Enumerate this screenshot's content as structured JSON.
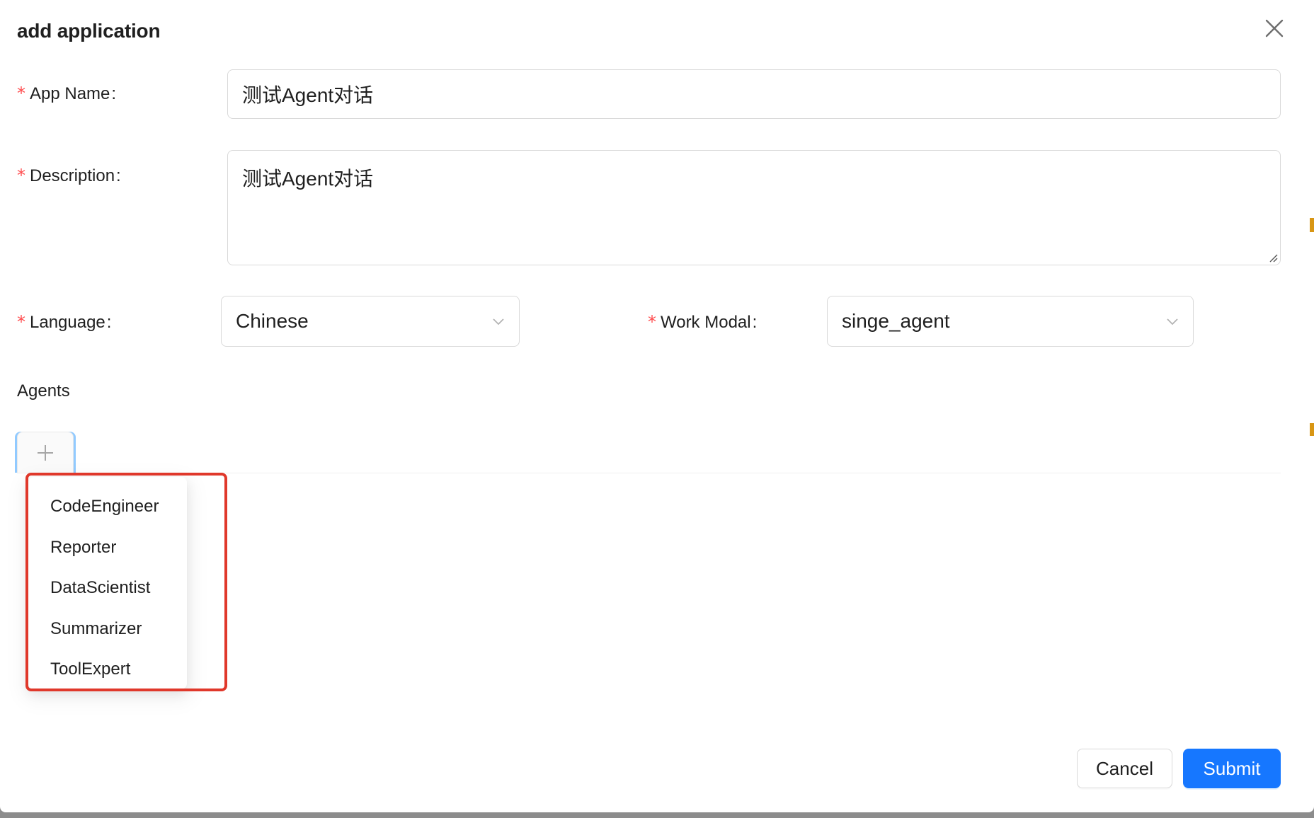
{
  "modal": {
    "title": "add application",
    "close_icon": "close-icon"
  },
  "form": {
    "app_name": {
      "label": "App Name",
      "value": "测试Agent对话",
      "required": true
    },
    "description": {
      "label": "Description",
      "value": "测试Agent对话",
      "required": true
    },
    "language": {
      "label": "Language",
      "value": "Chinese",
      "required": true
    },
    "work_modal": {
      "label": "Work Modal",
      "value": "singe_agent",
      "required": true
    },
    "colon": ":"
  },
  "agents": {
    "section_title": "Agents",
    "add_icon": "plus-icon",
    "dropdown_items": [
      "CodeEngineer",
      "Reporter",
      "DataScientist",
      "Summarizer",
      "ToolExpert"
    ]
  },
  "footer": {
    "cancel_label": "Cancel",
    "submit_label": "Submit"
  },
  "colors": {
    "primary": "#1677ff",
    "required_star": "#ff4d4f",
    "highlight_border": "#e0382b"
  }
}
